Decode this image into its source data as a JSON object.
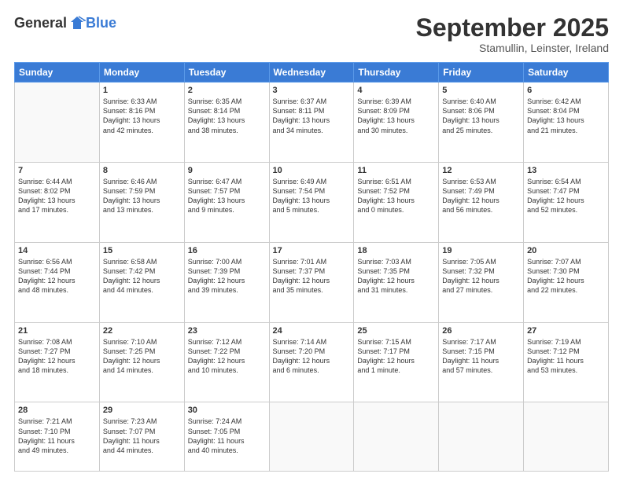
{
  "header": {
    "logo_general": "General",
    "logo_blue": "Blue",
    "month_title": "September 2025",
    "subtitle": "Stamullin, Leinster, Ireland"
  },
  "days_of_week": [
    "Sunday",
    "Monday",
    "Tuesday",
    "Wednesday",
    "Thursday",
    "Friday",
    "Saturday"
  ],
  "weeks": [
    [
      {
        "day": "",
        "info": ""
      },
      {
        "day": "1",
        "info": "Sunrise: 6:33 AM\nSunset: 8:16 PM\nDaylight: 13 hours\nand 42 minutes."
      },
      {
        "day": "2",
        "info": "Sunrise: 6:35 AM\nSunset: 8:14 PM\nDaylight: 13 hours\nand 38 minutes."
      },
      {
        "day": "3",
        "info": "Sunrise: 6:37 AM\nSunset: 8:11 PM\nDaylight: 13 hours\nand 34 minutes."
      },
      {
        "day": "4",
        "info": "Sunrise: 6:39 AM\nSunset: 8:09 PM\nDaylight: 13 hours\nand 30 minutes."
      },
      {
        "day": "5",
        "info": "Sunrise: 6:40 AM\nSunset: 8:06 PM\nDaylight: 13 hours\nand 25 minutes."
      },
      {
        "day": "6",
        "info": "Sunrise: 6:42 AM\nSunset: 8:04 PM\nDaylight: 13 hours\nand 21 minutes."
      }
    ],
    [
      {
        "day": "7",
        "info": "Sunrise: 6:44 AM\nSunset: 8:02 PM\nDaylight: 13 hours\nand 17 minutes."
      },
      {
        "day": "8",
        "info": "Sunrise: 6:46 AM\nSunset: 7:59 PM\nDaylight: 13 hours\nand 13 minutes."
      },
      {
        "day": "9",
        "info": "Sunrise: 6:47 AM\nSunset: 7:57 PM\nDaylight: 13 hours\nand 9 minutes."
      },
      {
        "day": "10",
        "info": "Sunrise: 6:49 AM\nSunset: 7:54 PM\nDaylight: 13 hours\nand 5 minutes."
      },
      {
        "day": "11",
        "info": "Sunrise: 6:51 AM\nSunset: 7:52 PM\nDaylight: 13 hours\nand 0 minutes."
      },
      {
        "day": "12",
        "info": "Sunrise: 6:53 AM\nSunset: 7:49 PM\nDaylight: 12 hours\nand 56 minutes."
      },
      {
        "day": "13",
        "info": "Sunrise: 6:54 AM\nSunset: 7:47 PM\nDaylight: 12 hours\nand 52 minutes."
      }
    ],
    [
      {
        "day": "14",
        "info": "Sunrise: 6:56 AM\nSunset: 7:44 PM\nDaylight: 12 hours\nand 48 minutes."
      },
      {
        "day": "15",
        "info": "Sunrise: 6:58 AM\nSunset: 7:42 PM\nDaylight: 12 hours\nand 44 minutes."
      },
      {
        "day": "16",
        "info": "Sunrise: 7:00 AM\nSunset: 7:39 PM\nDaylight: 12 hours\nand 39 minutes."
      },
      {
        "day": "17",
        "info": "Sunrise: 7:01 AM\nSunset: 7:37 PM\nDaylight: 12 hours\nand 35 minutes."
      },
      {
        "day": "18",
        "info": "Sunrise: 7:03 AM\nSunset: 7:35 PM\nDaylight: 12 hours\nand 31 minutes."
      },
      {
        "day": "19",
        "info": "Sunrise: 7:05 AM\nSunset: 7:32 PM\nDaylight: 12 hours\nand 27 minutes."
      },
      {
        "day": "20",
        "info": "Sunrise: 7:07 AM\nSunset: 7:30 PM\nDaylight: 12 hours\nand 22 minutes."
      }
    ],
    [
      {
        "day": "21",
        "info": "Sunrise: 7:08 AM\nSunset: 7:27 PM\nDaylight: 12 hours\nand 18 minutes."
      },
      {
        "day": "22",
        "info": "Sunrise: 7:10 AM\nSunset: 7:25 PM\nDaylight: 12 hours\nand 14 minutes."
      },
      {
        "day": "23",
        "info": "Sunrise: 7:12 AM\nSunset: 7:22 PM\nDaylight: 12 hours\nand 10 minutes."
      },
      {
        "day": "24",
        "info": "Sunrise: 7:14 AM\nSunset: 7:20 PM\nDaylight: 12 hours\nand 6 minutes."
      },
      {
        "day": "25",
        "info": "Sunrise: 7:15 AM\nSunset: 7:17 PM\nDaylight: 12 hours\nand 1 minute."
      },
      {
        "day": "26",
        "info": "Sunrise: 7:17 AM\nSunset: 7:15 PM\nDaylight: 11 hours\nand 57 minutes."
      },
      {
        "day": "27",
        "info": "Sunrise: 7:19 AM\nSunset: 7:12 PM\nDaylight: 11 hours\nand 53 minutes."
      }
    ],
    [
      {
        "day": "28",
        "info": "Sunrise: 7:21 AM\nSunset: 7:10 PM\nDaylight: 11 hours\nand 49 minutes."
      },
      {
        "day": "29",
        "info": "Sunrise: 7:23 AM\nSunset: 7:07 PM\nDaylight: 11 hours\nand 44 minutes."
      },
      {
        "day": "30",
        "info": "Sunrise: 7:24 AM\nSunset: 7:05 PM\nDaylight: 11 hours\nand 40 minutes."
      },
      {
        "day": "",
        "info": ""
      },
      {
        "day": "",
        "info": ""
      },
      {
        "day": "",
        "info": ""
      },
      {
        "day": "",
        "info": ""
      }
    ]
  ]
}
